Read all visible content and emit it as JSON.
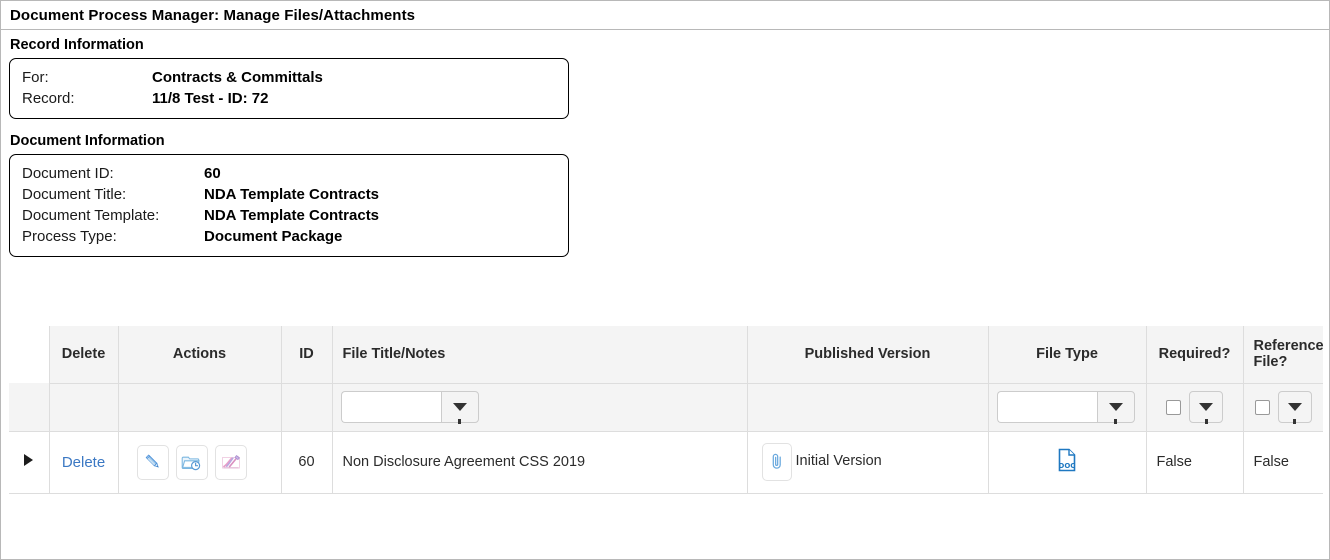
{
  "window": {
    "title": "Document Process Manager: Manage Files/Attachments"
  },
  "record_information": {
    "heading": "Record Information",
    "rows": [
      {
        "label": "For:",
        "value": "Contracts & Committals"
      },
      {
        "label": "Record:",
        "value": "11/8 Test - ID: 72"
      }
    ]
  },
  "document_information": {
    "heading": "Document Information",
    "rows": [
      {
        "label": "Document ID:",
        "value": "60"
      },
      {
        "label": "Document Title:",
        "value": "NDA Template Contracts"
      },
      {
        "label": "Document Template:",
        "value": "NDA Template Contracts"
      },
      {
        "label": "Process Type:",
        "value": "Document Package"
      }
    ]
  },
  "grid": {
    "headers": {
      "expand": "",
      "delete": "Delete",
      "actions": "Actions",
      "id": "ID",
      "title": "File Title/Notes",
      "published_version": "Published Version",
      "file_type": "File Type",
      "required": "Required?",
      "reference_file": "Reference File?"
    },
    "filter_row": {
      "title_value": "",
      "title_placeholder": "",
      "file_type_value": "",
      "file_type_placeholder": "",
      "required_checked": false,
      "reference_checked": false,
      "filter_icon": "filter-funnel-icon"
    },
    "rows": [
      {
        "expand_icon": "expand-triangle-icon",
        "delete_label": "Delete",
        "actions": [
          {
            "icon": "edit-pencil-icon",
            "name": "edit-file-button"
          },
          {
            "icon": "folder-history-icon",
            "name": "file-versions-button"
          },
          {
            "icon": "signature-icon",
            "name": "sign-file-button"
          }
        ],
        "id": "60",
        "title": "Non Disclosure Agreement CSS 2019",
        "published_version": "Initial Version",
        "published_version_icon": "paperclip-attachment-icon",
        "file_type_icon": "doc-file-icon",
        "required": "False",
        "reference_file": "False"
      }
    ]
  },
  "colors": {
    "link": "#3b78c3",
    "header_bg": "#f4f4f4",
    "border": "#dddddd",
    "outer_border": "#b8b8b8",
    "icon_blue": "#5b9bd5",
    "icon_pink": "#e8a0c8",
    "doc_icon_blue": "#1f78c1"
  }
}
